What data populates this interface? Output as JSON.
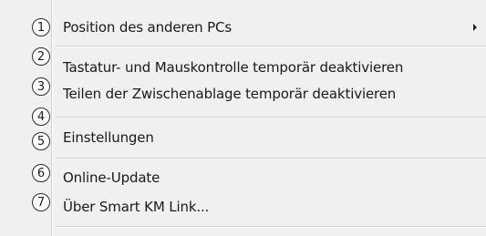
{
  "menu": {
    "items": [
      {
        "label": "Position des anderen PCs",
        "callout": "1"
      },
      {
        "label": "Tastatur- und Mauskontrolle temporär deaktivieren",
        "callout": "2"
      },
      {
        "label": "Teilen der Zwischenablage temporär deaktivieren",
        "callout": "3"
      },
      {
        "label": "",
        "callout": "4"
      },
      {
        "label": "Einstellungen",
        "callout": "5"
      },
      {
        "label": "Online-Update",
        "callout": "6"
      },
      {
        "label": "Über Smart KM Link...",
        "callout": "7"
      }
    ],
    "submenu_icon": "chevron-right-icon"
  }
}
